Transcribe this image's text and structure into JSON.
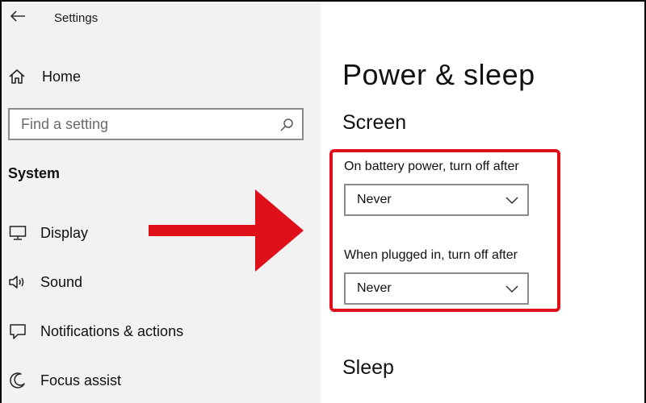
{
  "window": {
    "title": "Settings"
  },
  "sidebar": {
    "home_label": "Home",
    "search_placeholder": "Find a setting",
    "section_label": "System",
    "items": [
      {
        "label": "Display",
        "icon": "display-icon"
      },
      {
        "label": "Sound",
        "icon": "sound-icon"
      },
      {
        "label": "Notifications & actions",
        "icon": "notifications-icon"
      },
      {
        "label": "Focus assist",
        "icon": "focus-assist-icon"
      }
    ]
  },
  "main": {
    "page_title": "Power & sleep",
    "screen_heading": "Screen",
    "battery_label": "On battery power, turn off after",
    "battery_value": "Never",
    "plugged_label": "When plugged in, turn off after",
    "plugged_value": "Never",
    "sleep_heading": "Sleep"
  },
  "colors": {
    "sidebar_bg": "#f2f2f2",
    "main_bg": "#ffffff",
    "highlight": "#e0101a",
    "annotation_arrow": "#e0101a"
  }
}
